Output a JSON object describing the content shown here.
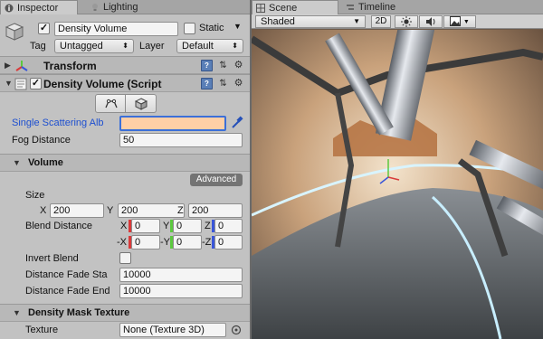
{
  "tabs": {
    "inspector": "Inspector",
    "lighting": "Lighting",
    "scene": "Scene",
    "timeline": "Timeline"
  },
  "gameobject": {
    "name": "Density Volume",
    "active": true,
    "static_label": "Static",
    "tag_label": "Tag",
    "tag_value": "Untagged",
    "layer_label": "Layer",
    "layer_value": "Default"
  },
  "components": {
    "transform": "Transform",
    "density_volume": "Density Volume (Script"
  },
  "fields": {
    "single_scattering_label": "Single Scattering Alb",
    "single_scattering_color": "#ffcfa6",
    "fog_distance_label": "Fog Distance",
    "fog_distance_value": "50"
  },
  "volume": {
    "section_label": "Volume",
    "advanced_label": "Advanced",
    "size_label": "Size",
    "size_x": "200",
    "size_y": "200",
    "size_z": "200",
    "axis_x": "X",
    "axis_y": "Y",
    "axis_z": "Z",
    "axis_neg_x": "-X",
    "axis_neg_y": "-Y",
    "axis_neg_z": "-Z",
    "blend_distance_label": "Blend Distance",
    "blend_pos_x": "0",
    "blend_pos_y": "0",
    "blend_pos_z": "0",
    "blend_neg_x": "0",
    "blend_neg_y": "0",
    "blend_neg_z": "0",
    "invert_blend_label": "Invert Blend",
    "distance_fade_start_label": "Distance Fade Sta",
    "distance_fade_start_value": "10000",
    "distance_fade_end_label": "Distance Fade End",
    "distance_fade_end_value": "10000"
  },
  "density_mask": {
    "section_label": "Density Mask Texture",
    "texture_label": "Texture",
    "texture_value": "None (Texture 3D)"
  },
  "scene_toolbar": {
    "shading_mode": "Shaded",
    "mode_2d": "2D"
  },
  "colors": {
    "axis_x": "#d93a3a",
    "axis_y": "#5cc93f",
    "axis_z": "#3a56d9",
    "selection_blue": "#3b6fd8"
  }
}
